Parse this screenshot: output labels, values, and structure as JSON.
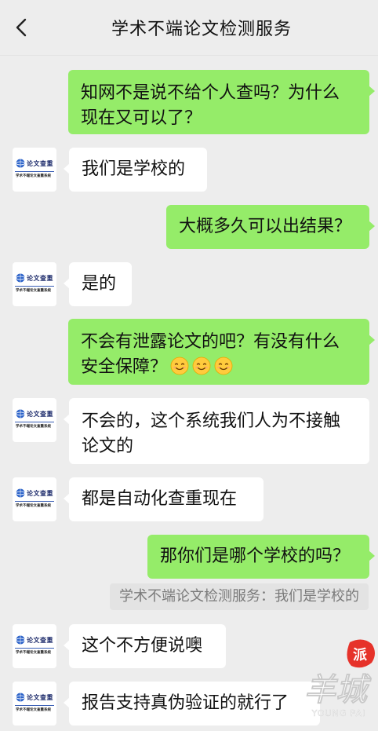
{
  "header": {
    "title": "学术不端论文检测服务",
    "back_icon": "chevron-left-icon"
  },
  "colors": {
    "outgoing_bubble": "#95ec69",
    "incoming_bubble": "#ffffff",
    "background": "#ededed",
    "watermark_red": "#e6322a"
  },
  "avatar": {
    "logo_text": "论文查重",
    "subtitle": "学术不端论文查重系统"
  },
  "messages": [
    {
      "side": "out",
      "line1": "知网不是说不给个人查吗？为什么",
      "line2": "现在又可以了？"
    },
    {
      "side": "in",
      "line1": "我们是学校的"
    },
    {
      "side": "out",
      "line1": "大概多久可以出结果？"
    },
    {
      "side": "in",
      "line1": "是的"
    },
    {
      "side": "out",
      "line1": "不会有泄露论文的吧？有没有什么",
      "line2": "安全保障？",
      "emoji": "smile-emoji"
    },
    {
      "side": "in",
      "line1": "不会的，这个系统我们人为不接触",
      "line2": "论文的"
    },
    {
      "side": "in",
      "line1": "都是自动化查重现在"
    },
    {
      "side": "out",
      "line1": "那你们是哪个学校的吗？"
    },
    {
      "side": "in",
      "line1": "这个不方便说噢"
    },
    {
      "side": "in",
      "line1": "报告支持真伪验证的就行了"
    }
  ],
  "quote": {
    "text": "学术不端论文检测服务：我们是学校的"
  },
  "watermark": {
    "seal_char": "派",
    "main_text": "羊城",
    "sub_text": "YOUNG PAI"
  }
}
